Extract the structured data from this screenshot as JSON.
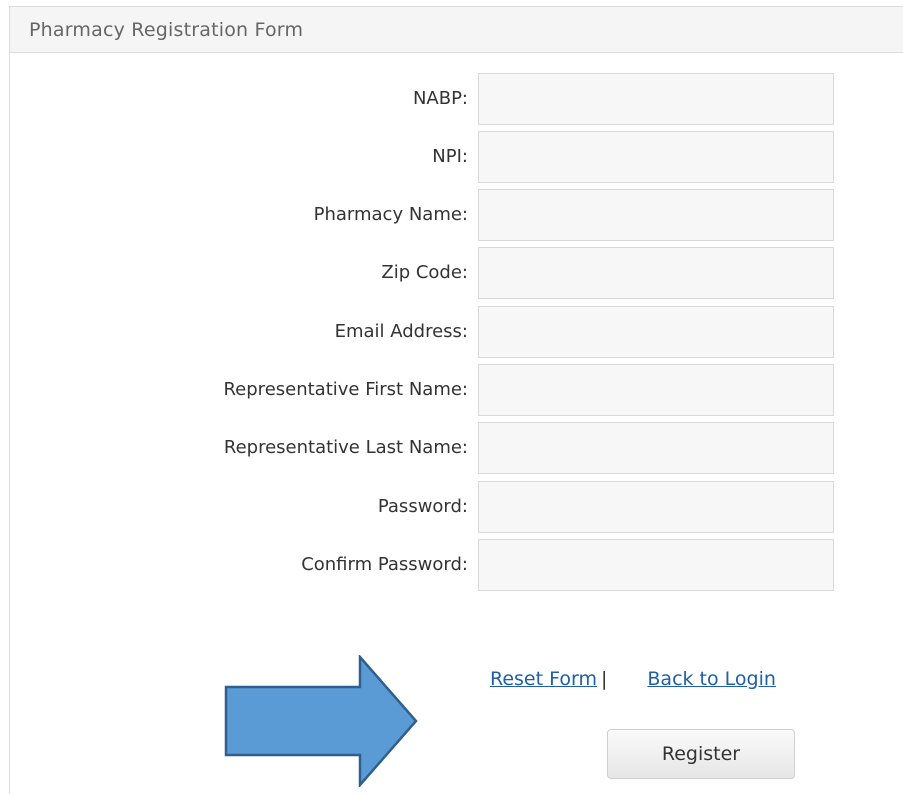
{
  "panel": {
    "title": "Pharmacy Registration Form"
  },
  "form": {
    "fields": [
      {
        "label": "NABP:",
        "value": ""
      },
      {
        "label": "NPI:",
        "value": ""
      },
      {
        "label": "Pharmacy Name:",
        "value": ""
      },
      {
        "label": "Zip Code:",
        "value": ""
      },
      {
        "label": "Email Address:",
        "value": ""
      },
      {
        "label": "Representative First Name:",
        "value": ""
      },
      {
        "label": "Representative Last Name:",
        "value": ""
      },
      {
        "label": "Password:",
        "value": ""
      },
      {
        "label": "Confirm Password:",
        "value": ""
      }
    ]
  },
  "links": {
    "reset_label": "Reset Form",
    "separator": "|",
    "back_label": "Back to Login"
  },
  "actions": {
    "register_label": "Register"
  },
  "annotation": {
    "arrow_icon": "right-arrow-icon",
    "arrow_color": "#5b9bd5",
    "arrow_border_color": "#2f5f8f"
  }
}
